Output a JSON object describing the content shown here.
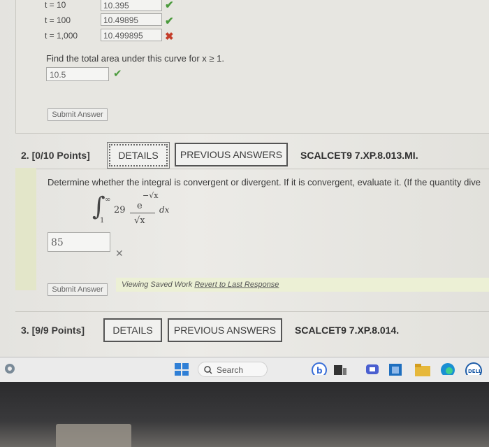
{
  "rows": [
    {
      "label": "t = 10",
      "value": "10.395",
      "status": "correct"
    },
    {
      "label": "t = 100",
      "value": "10.49895",
      "status": "correct"
    },
    {
      "label": "t = 1,000",
      "value": "10.499895",
      "status": "incorrect"
    }
  ],
  "area_question": "Find the total area under this curve for x ≥ 1.",
  "area_answer": "10.5",
  "submit_label": "Submit Answer",
  "q2": {
    "header": "2. [0/10 Points]",
    "details": "DETAILS",
    "prev": "PREVIOUS ANSWERS",
    "ref": "SCALCET9 7.XP.8.013.MI.",
    "prompt": "Determine whether the integral is convergent or divergent. If it is convergent, evaluate it. (If the quantity dive",
    "integral": {
      "upper": "∞",
      "lower": "1",
      "coef": "29",
      "num": "e",
      "num_exp": "−√x",
      "den": "√x",
      "dx": "dx"
    },
    "answer": "85",
    "viewing": "Viewing Saved Work",
    "revert": "Revert to Last Response"
  },
  "q3": {
    "header": "3. [9/9 Points]",
    "details": "DETAILS",
    "prev": "PREVIOUS ANSWERS",
    "ref": "SCALCET9 7.XP.8.014."
  },
  "taskbar": {
    "search": "Search"
  }
}
